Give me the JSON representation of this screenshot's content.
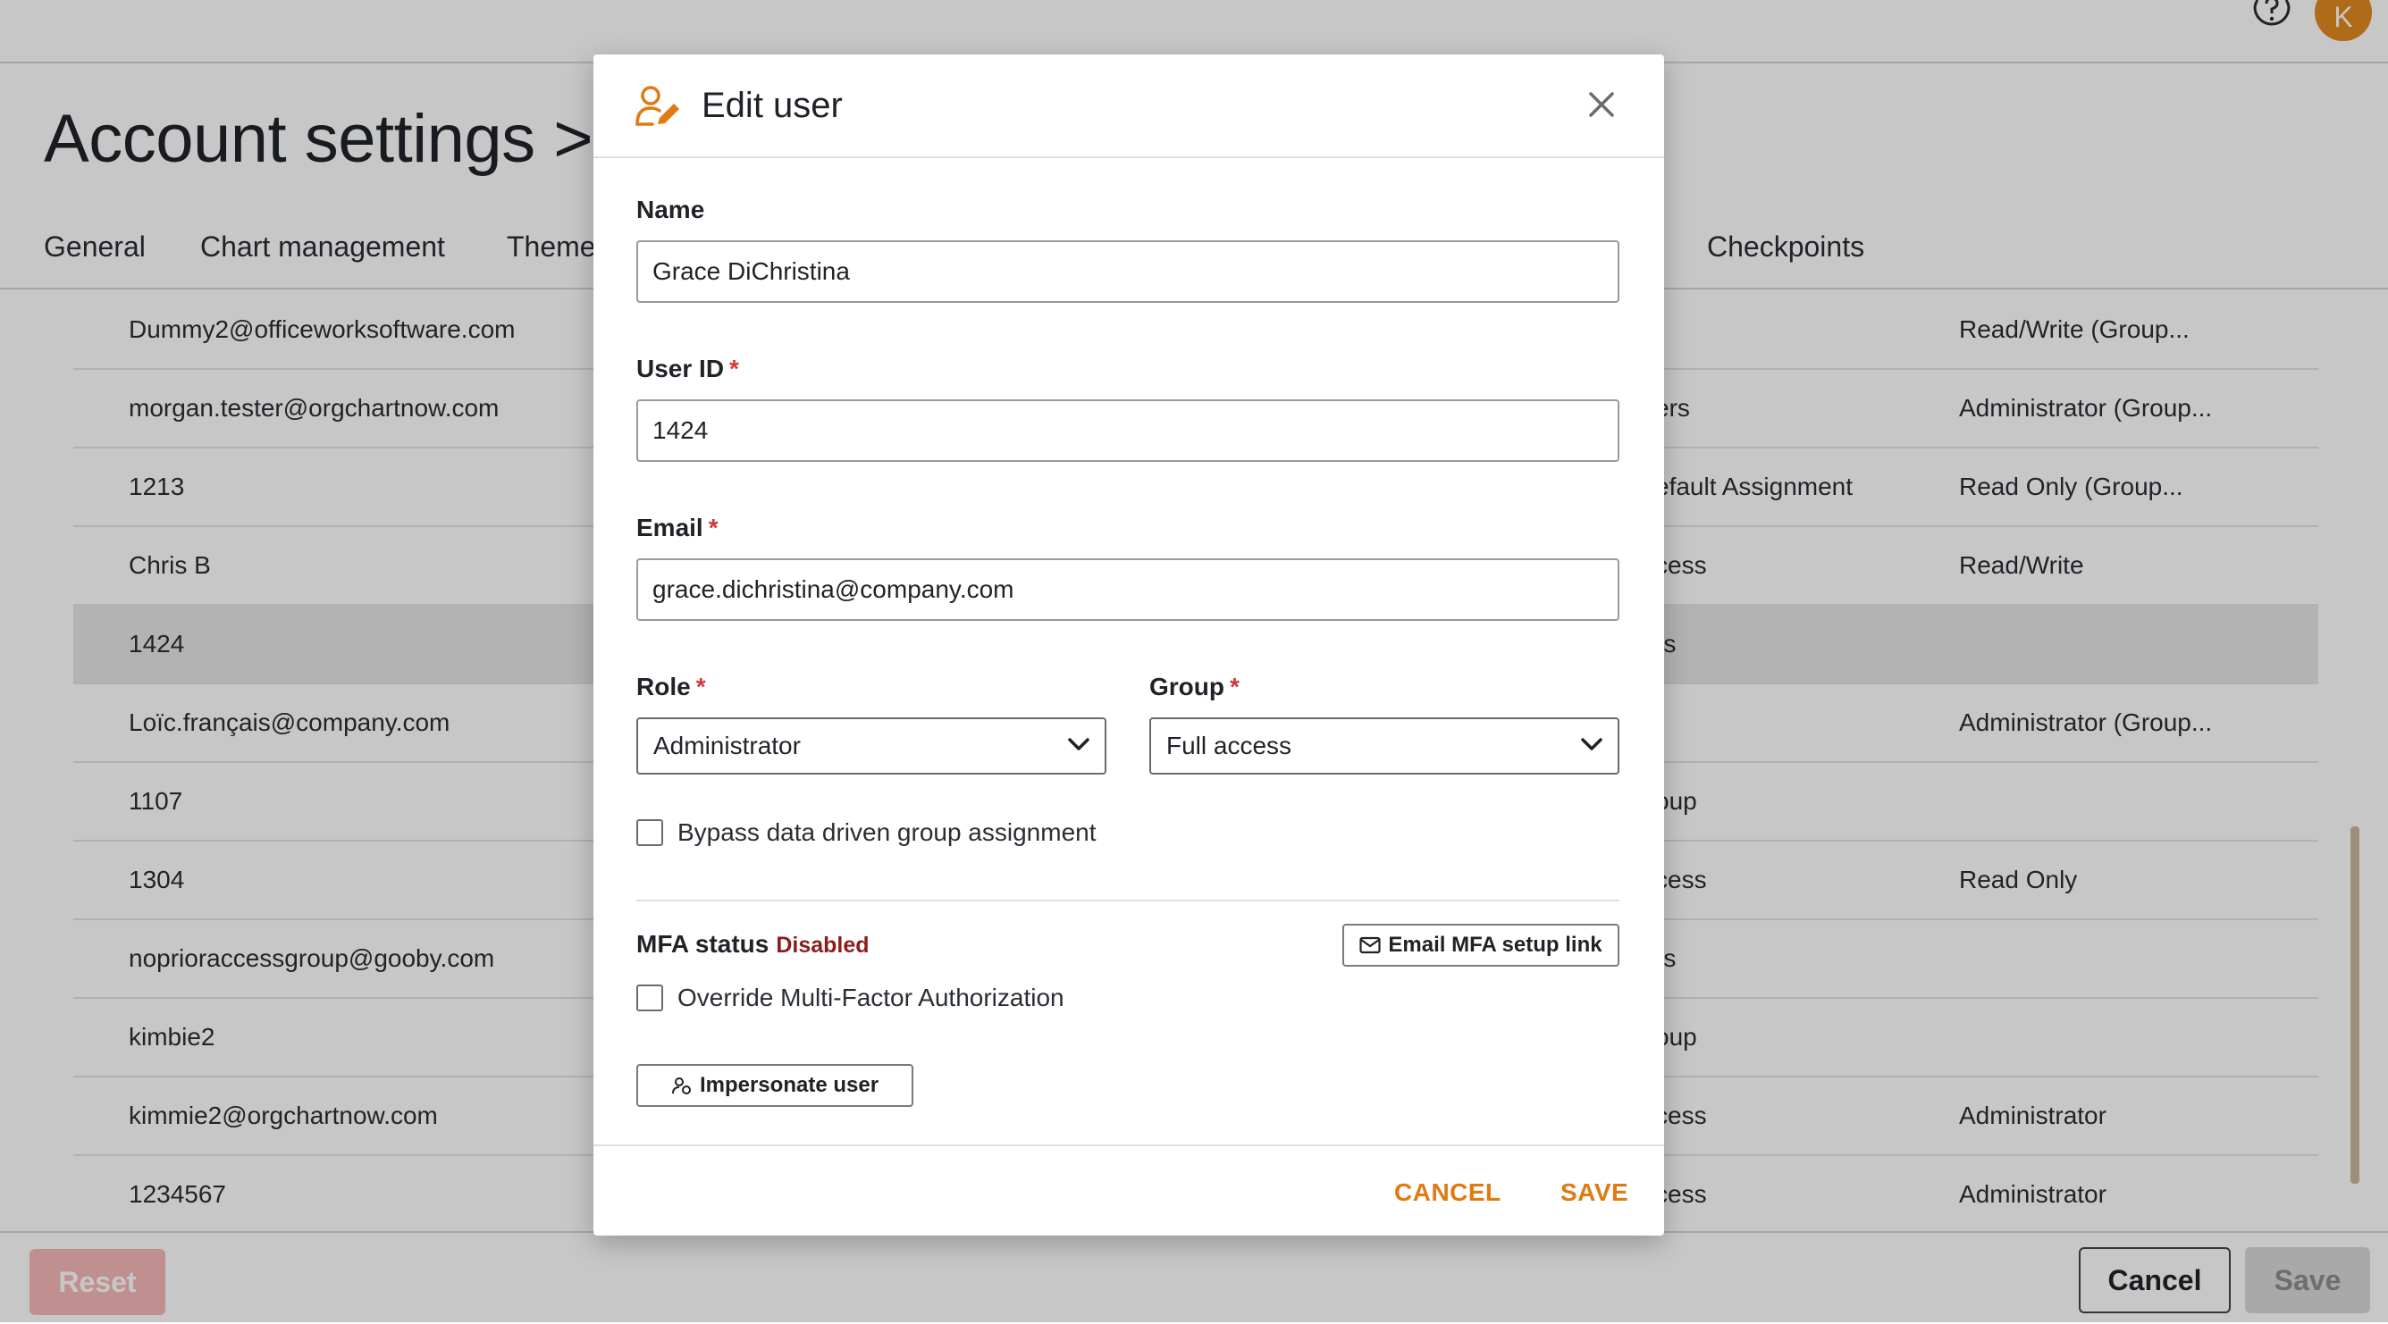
{
  "header": {
    "avatar_initial": "K",
    "help_icon": "question-circle-icon"
  },
  "page": {
    "title": "Account settings >"
  },
  "tabs": [
    {
      "label": "General"
    },
    {
      "label": "Chart management"
    },
    {
      "label": "Theme"
    },
    {
      "label": "Checkpoints"
    }
  ],
  "table": {
    "rows": [
      {
        "user": "Dummy2@officeworksoftware.com",
        "group": "",
        "role": "Read/Write (Group..."
      },
      {
        "user": "morgan.tester@orgchartnow.com",
        "group": "ers",
        "role": "Administrator (Group..."
      },
      {
        "user": "1213",
        "group": "efault Assignment",
        "role": "Read Only (Group..."
      },
      {
        "user": "Chris B",
        "group": "cess",
        "role": "Read/Write"
      },
      {
        "user": "1424",
        "group": "rs",
        "role": "",
        "selected": true
      },
      {
        "user": "Loïc.français@company.com",
        "group": "",
        "role": "Administrator (Group..."
      },
      {
        "user": "1107",
        "group": "oup",
        "role": ""
      },
      {
        "user": "1304",
        "group": "cess",
        "role": "Read Only"
      },
      {
        "user": "noprioraccessgroup@gooby.com",
        "group": "rs",
        "role": ""
      },
      {
        "user": "kimbie2",
        "group": "oup",
        "role": ""
      },
      {
        "user": "kimmie2@orgchartnow.com",
        "group": "cess",
        "role": "Administrator"
      },
      {
        "user": "1234567",
        "group": "cess",
        "role": "Administrator"
      }
    ]
  },
  "footer": {
    "reset_label": "Reset",
    "cancel_label": "Cancel",
    "save_label": "Save"
  },
  "modal": {
    "title": "Edit user",
    "name_label": "Name",
    "name_value": "Grace DiChristina",
    "user_id_label": "User ID",
    "user_id_value": "1424",
    "email_label": "Email",
    "email_value": "grace.dichristina@company.com",
    "required_mark": "*",
    "role_label": "Role",
    "role_value": "Administrator",
    "group_label": "Group",
    "group_value": "Full access",
    "bypass_label": "Bypass data driven group assignment",
    "mfa_status_label": "MFA status",
    "mfa_status_value": "Disabled",
    "email_mfa_label": "Email MFA setup link",
    "override_mfa_label": "Override Multi-Factor Authorization",
    "impersonate_label": "Impersonate user",
    "cancel_label": "CANCEL",
    "save_label": "SAVE"
  },
  "colors": {
    "accent": "#e07a12",
    "avatar": "#e08a1e",
    "mfa_disabled": "#8b1c1c",
    "required": "#d23838"
  }
}
